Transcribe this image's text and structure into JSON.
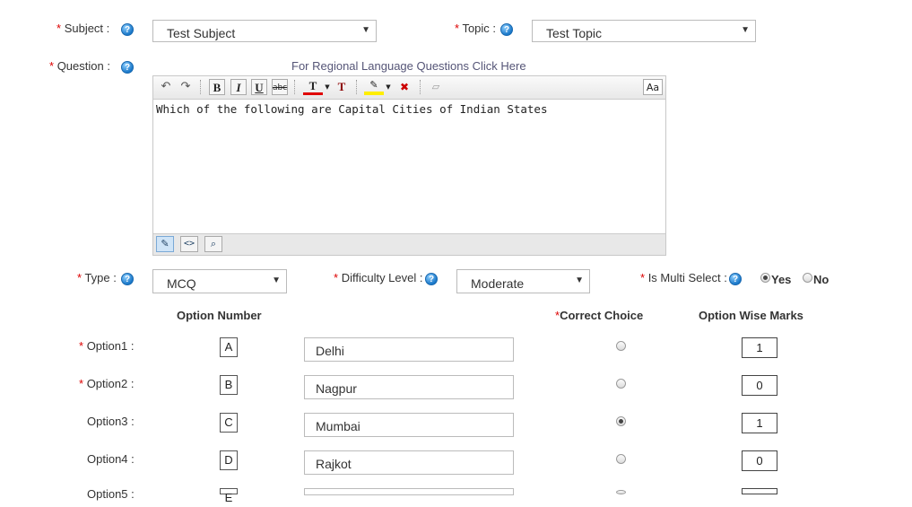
{
  "subject": {
    "label": "Subject :",
    "value": "Test Subject"
  },
  "topic": {
    "label": "Topic :",
    "value": "Test Topic"
  },
  "question": {
    "label": "Question :",
    "regional_link": "For Regional Language Questions Click Here",
    "text": "Which of the following are Capital Cities of Indian States",
    "toolbar": {
      "bold": "B",
      "italic": "I",
      "underline": "U",
      "strike": "abc",
      "text_color": "T",
      "remove_format": "T",
      "font_size": "Aa"
    }
  },
  "type": {
    "label": "Type :",
    "value": "MCQ"
  },
  "difficulty": {
    "label": "Difficulty Level :",
    "value": "Moderate"
  },
  "multi_select": {
    "label": "Is Multi Select :",
    "yes": "Yes",
    "no": "No",
    "selected": "Yes"
  },
  "required_mark": "*",
  "headers": {
    "option_number": "Option Number",
    "correct_choice": "Correct Choice",
    "option_wise_marks": "Option Wise Marks"
  },
  "options": [
    {
      "label": "Option1 :",
      "required": true,
      "letter": "A",
      "value": "Delhi",
      "correct": false,
      "marks": "1"
    },
    {
      "label": "Option2 :",
      "required": true,
      "letter": "B",
      "value": "Nagpur",
      "correct": false,
      "marks": "0"
    },
    {
      "label": "Option3 :",
      "required": false,
      "letter": "C",
      "value": "Mumbai",
      "correct": true,
      "marks": "1"
    },
    {
      "label": "Option4 :",
      "required": false,
      "letter": "D",
      "value": "Rajkot",
      "correct": false,
      "marks": "0"
    },
    {
      "label": "Option5 :",
      "required": false,
      "letter": "E",
      "value": "",
      "correct": false,
      "marks": ""
    }
  ],
  "icons": {
    "help": "help-icon",
    "undo": "undo-icon",
    "redo": "redo-icon",
    "highlight": "highlight-icon",
    "eraser": "eraser-icon",
    "design": "design-mode-icon",
    "html": "html-mode-icon",
    "preview": "preview-icon"
  },
  "colors": {
    "required": "#dd0000",
    "help_blue": "#1a78c9",
    "text_color_bar": "#e00000",
    "highlight_bar": "#ffee00"
  }
}
